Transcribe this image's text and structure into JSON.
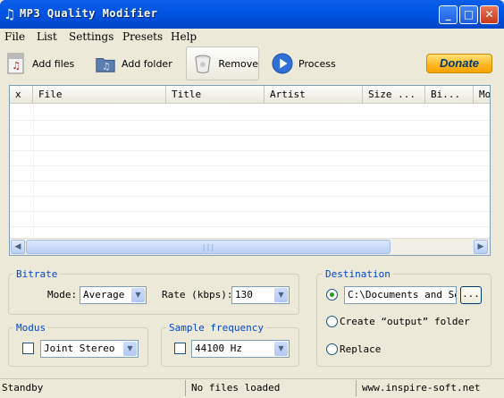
{
  "window": {
    "title": "MP3 Quality Modifier",
    "app_icon": "music-note-icon",
    "caption_buttons": [
      "minimize",
      "maximize",
      "close"
    ]
  },
  "menu": [
    "File",
    "List",
    "Settings",
    "Presets",
    "Help"
  ],
  "toolbar": {
    "add_files": "Add files",
    "add_folder": "Add folder",
    "remove": "Remove",
    "process": "Process",
    "donate": "Donate"
  },
  "list": {
    "columns": [
      "x",
      "File",
      "Title",
      "Artist",
      "Size ...",
      "Bi...",
      "Mo"
    ],
    "rows": []
  },
  "bitrate": {
    "legend": "Bitrate",
    "mode_label": "Mode:",
    "mode_value": "Average",
    "rate_label": "Rate (kbps):",
    "rate_value": "130"
  },
  "modus": {
    "legend": "Modus",
    "value": "Joint Stereo",
    "checked": false
  },
  "sample_frequency": {
    "legend": "Sample frequency",
    "value": "44100 Hz",
    "checked": false
  },
  "destination": {
    "legend": "Destination",
    "path": "C:\\Documents and Set",
    "browse": "...",
    "option_create": "Create “output” folder",
    "option_replace": "Replace",
    "selected": "path"
  },
  "status": {
    "left": "Standby",
    "middle": "No files loaded",
    "right": "www.inspire-soft.net"
  },
  "colors": {
    "titlebar": "#0054e3",
    "group_label": "#0046d5",
    "donate": "#ffb51c"
  }
}
